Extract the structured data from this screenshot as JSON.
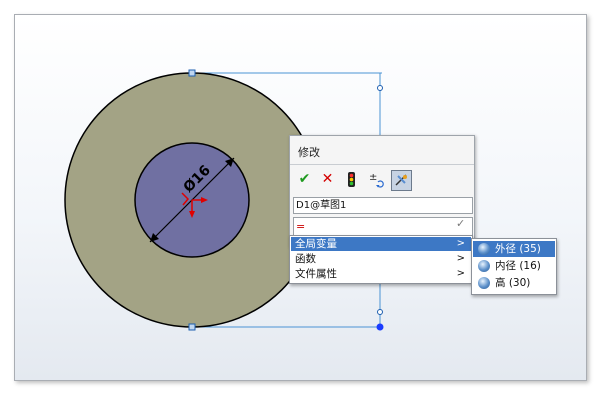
{
  "canvas": {
    "dimension_label": "Ø16"
  },
  "modify_dialog": {
    "title": "修改",
    "name_field_value": "D1@草图1",
    "value_field_value": "="
  },
  "context_menu": {
    "items": [
      {
        "label": "全局变量",
        "arrow": ">"
      },
      {
        "label": "函数",
        "arrow": ">"
      },
      {
        "label": "文件属性",
        "arrow": ">"
      }
    ]
  },
  "submenu": {
    "items": [
      {
        "label": "外径 (35)"
      },
      {
        "label": "内径 (16)"
      },
      {
        "label": "高 (30)"
      }
    ]
  },
  "colors": {
    "outer_ring": "#a3a385",
    "inner_circle": "#7070a2",
    "sketch_line": "#3a86ce",
    "highlight": "#3d78c5"
  },
  "icons": {
    "ok": "✔",
    "cancel": "✕",
    "plus_minus": "±"
  }
}
